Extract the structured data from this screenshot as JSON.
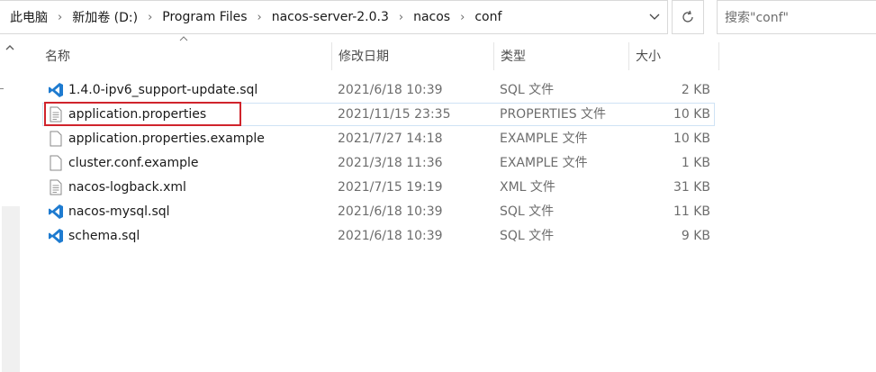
{
  "address": {
    "crumbs": [
      "此电脑",
      "新加卷 (D:)",
      "Program Files",
      "nacos-server-2.0.3",
      "nacos",
      "conf"
    ]
  },
  "search": {
    "placeholder": "搜索\"conf\""
  },
  "columns": {
    "name": "名称",
    "date": "修改日期",
    "type": "类型",
    "size": "大小"
  },
  "files": [
    {
      "name": "1.4.0-ipv6_support-update.sql",
      "date": "2021/6/18 10:39",
      "type": "SQL 文件",
      "size": "2 KB",
      "icon": "vscode-icon"
    },
    {
      "name": "application.properties",
      "date": "2021/11/15 23:35",
      "type": "PROPERTIES 文件",
      "size": "10 KB",
      "icon": "text-file-icon"
    },
    {
      "name": "application.properties.example",
      "date": "2021/7/27 14:18",
      "type": "EXAMPLE 文件",
      "size": "10 KB",
      "icon": "blank-file-icon"
    },
    {
      "name": "cluster.conf.example",
      "date": "2021/3/18 11:36",
      "type": "EXAMPLE 文件",
      "size": "1 KB",
      "icon": "blank-file-icon"
    },
    {
      "name": "nacos-logback.xml",
      "date": "2021/7/15 19:19",
      "type": "XML 文件",
      "size": "31 KB",
      "icon": "text-file-icon"
    },
    {
      "name": "nacos-mysql.sql",
      "date": "2021/6/18 10:39",
      "type": "SQL 文件",
      "size": "11 KB",
      "icon": "vscode-icon"
    },
    {
      "name": "schema.sql",
      "date": "2021/6/18 10:39",
      "type": "SQL 文件",
      "size": "9 KB",
      "icon": "vscode-icon"
    }
  ],
  "colors": {
    "vscode_blue": "#1e7bd0",
    "highlight_red": "#d0242c",
    "selected_border": "#cfe3f5"
  }
}
